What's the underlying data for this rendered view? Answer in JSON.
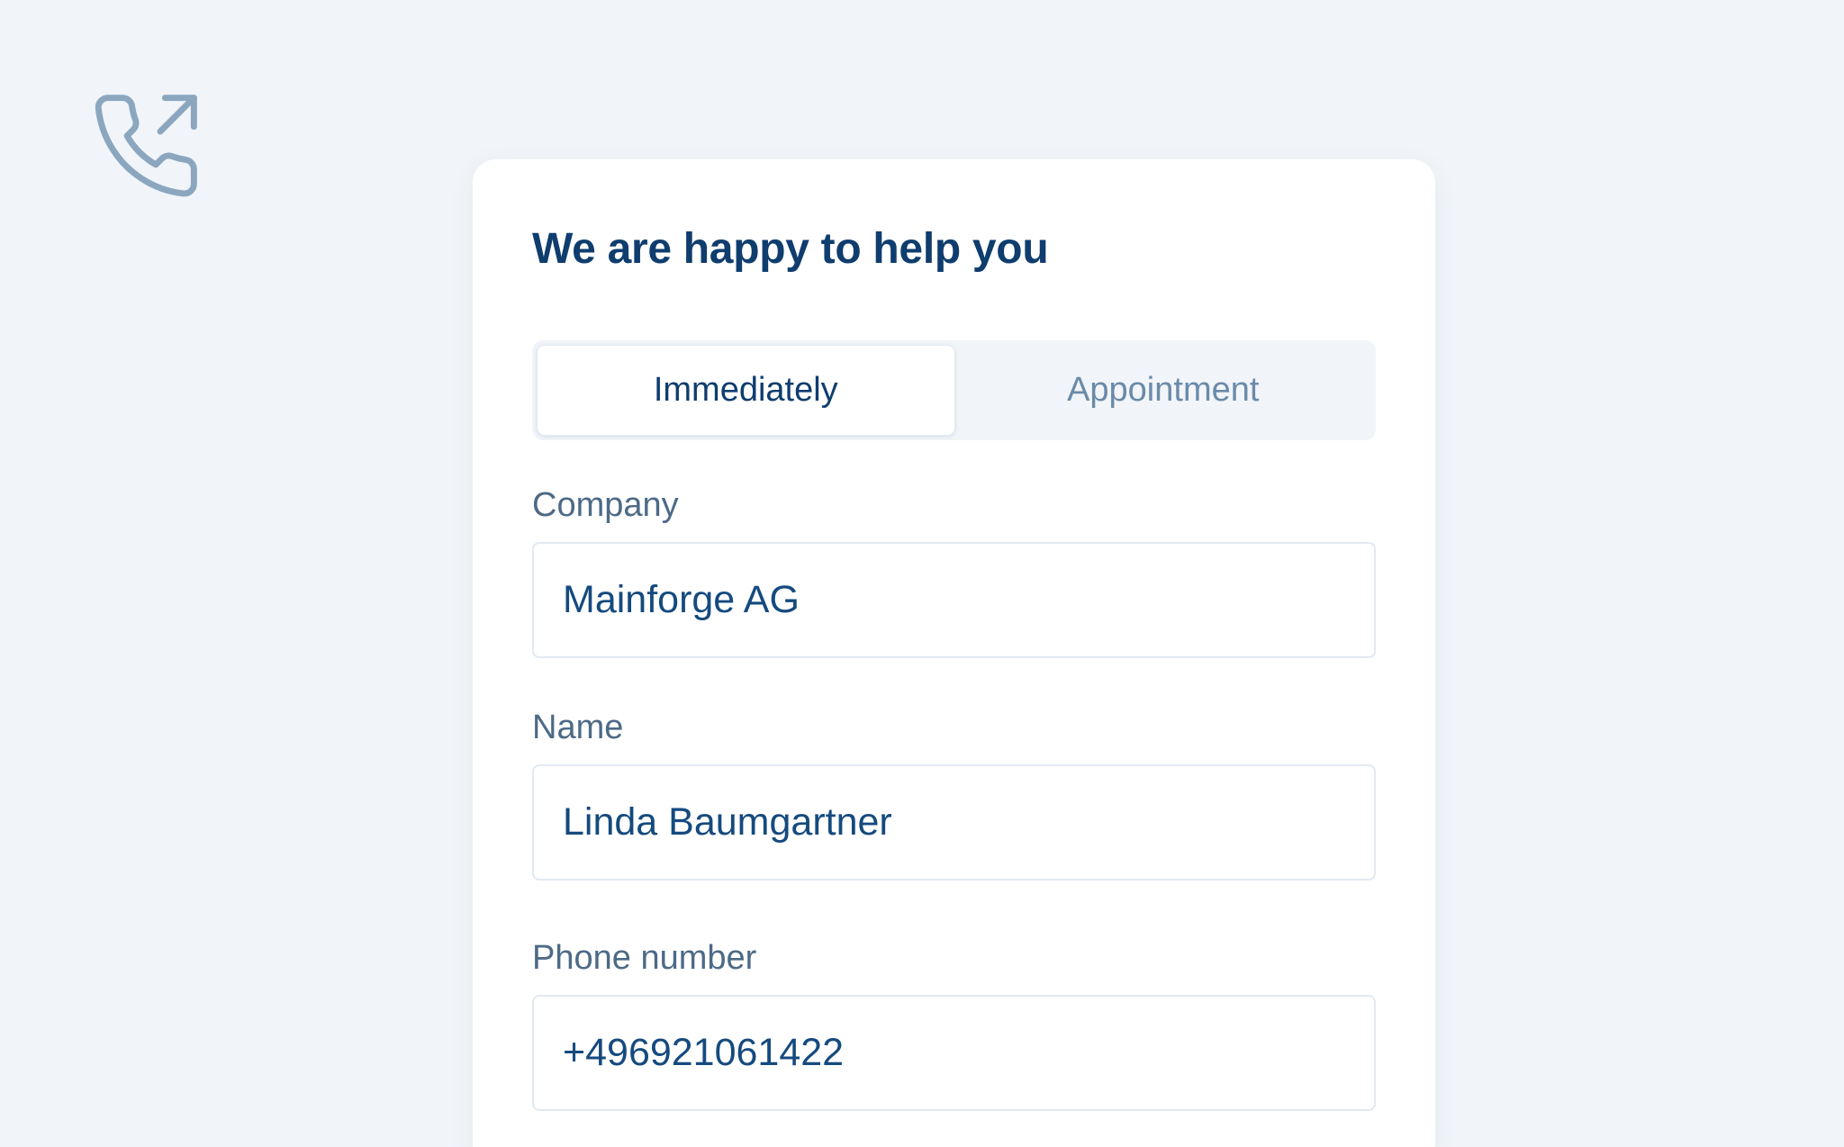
{
  "icon": "phone-outgoing-icon",
  "colors": {
    "page_bg": "#f1f5f9",
    "card_bg": "#ffffff",
    "title": "#0f3d6e",
    "label": "#4d6a86",
    "value": "#154a7e",
    "icon": "#8ba6bf"
  },
  "form": {
    "title": "We are happy to help you",
    "tabs": [
      {
        "label": "Immediately",
        "active": true
      },
      {
        "label": "Appointment",
        "active": false
      }
    ],
    "fields": [
      {
        "label": "Company",
        "value": "Mainforge AG"
      },
      {
        "label": "Name",
        "value": "Linda Baumgartner"
      },
      {
        "label": "Phone number",
        "value": "+496921061422"
      }
    ]
  }
}
